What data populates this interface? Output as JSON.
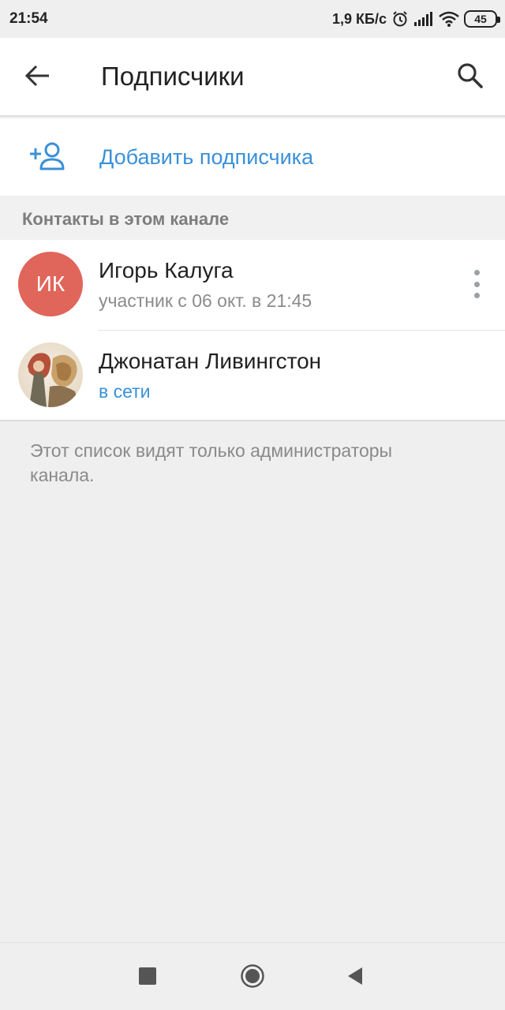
{
  "status_bar": {
    "time": "21:54",
    "network_speed": "1,9 КБ/с",
    "battery": "45",
    "icons": [
      "alarm-icon",
      "signal-icon",
      "wifi-icon",
      "battery-icon"
    ]
  },
  "app_bar": {
    "title": "Подписчики",
    "back_icon": "arrow-left-icon",
    "search_icon": "search-icon"
  },
  "add_subscriber": {
    "label": "Добавить подписчика",
    "icon": "add-user-icon"
  },
  "section": {
    "title": "Контакты в этом канале"
  },
  "contacts": [
    {
      "initials": "ИК",
      "name": "Игорь Калуга",
      "status": "участник с 06 окт. в 21:45",
      "avatar_color": "#e0655a"
    },
    {
      "name": "Джонатан Ливингстон",
      "status": "в сети",
      "avatar_icon": "photo-avatar"
    }
  ],
  "footer_note": "Этот список видят только администраторы канала.",
  "colors": {
    "accent": "#3a90d8",
    "background": "#efefef",
    "avatar_red": "#e0655a"
  },
  "nav_bar": {
    "icons": [
      "recent-apps-icon",
      "home-icon",
      "back-triangle-icon"
    ]
  }
}
